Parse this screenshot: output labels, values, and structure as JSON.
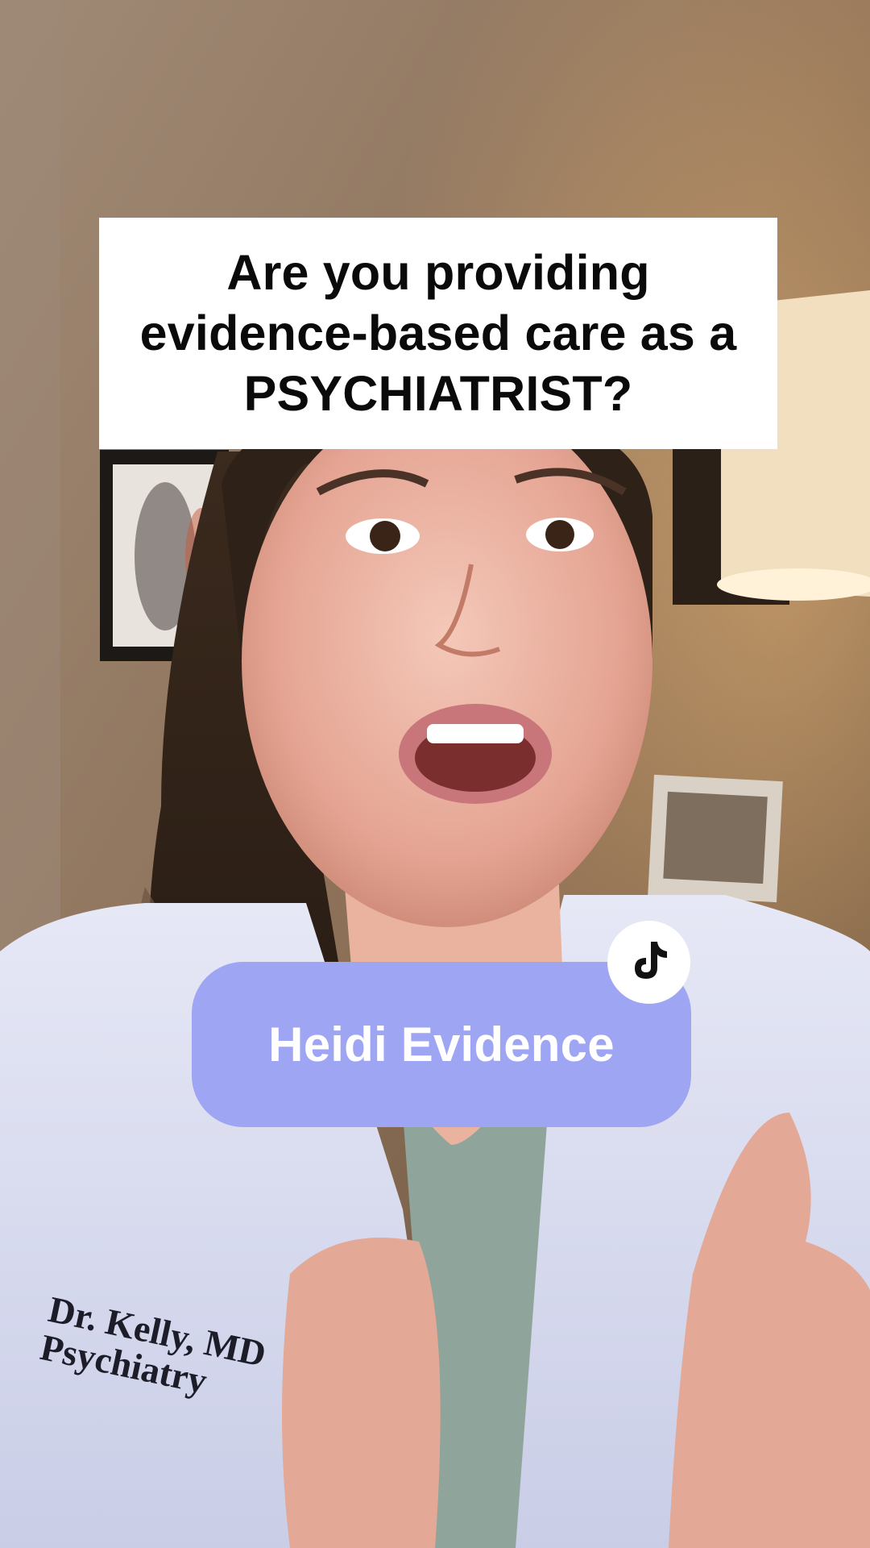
{
  "caption": {
    "lines": [
      "Are you providing",
      "evidence-based care as a",
      "PSYCHIATRIST?"
    ]
  },
  "brand": {
    "label": "Heidi Evidence",
    "badge_icon": "tiktok-icon"
  },
  "coat_embroidery": {
    "lines": [
      "Dr. Kelly, MD",
      "Psychiatry"
    ]
  },
  "colors": {
    "pill": "#9ea5f2",
    "caption_bg": "#ffffff",
    "caption_text": "#0a0a0a"
  }
}
